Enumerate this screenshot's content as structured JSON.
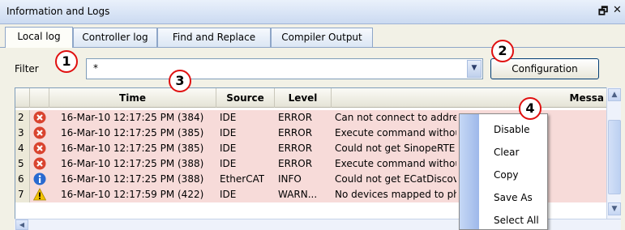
{
  "window": {
    "title": "Information and Logs",
    "pin_glyph": "🗗",
    "close_glyph": "✕"
  },
  "tabs": [
    {
      "label": "Local log",
      "active": true
    },
    {
      "label": "Controller log",
      "active": false
    },
    {
      "label": "Find and Replace",
      "active": false
    },
    {
      "label": "Compiler Output",
      "active": false
    }
  ],
  "filter": {
    "label": "Filter",
    "value": "*"
  },
  "configuration_button": "Configuration",
  "columns": {
    "time": "Time",
    "source": "Source",
    "level": "Level",
    "message": "Messa"
  },
  "rows": [
    {
      "num": "2",
      "icon": "error",
      "time": "16-Mar-10 12:17:25 PM (384)",
      "source": "IDE",
      "level": "ERROR",
      "message": "Can not connect to addre"
    },
    {
      "num": "3",
      "icon": "error",
      "time": "16-Mar-10 12:17:25 PM (385)",
      "source": "IDE",
      "level": "ERROR",
      "message": "Execute command withou"
    },
    {
      "num": "4",
      "icon": "error",
      "time": "16-Mar-10 12:17:25 PM (385)",
      "source": "IDE",
      "level": "ERROR",
      "message": "Could not get SinopeRTE"
    },
    {
      "num": "5",
      "icon": "error",
      "time": "16-Mar-10 12:17:25 PM (388)",
      "source": "IDE",
      "level": "ERROR",
      "message": "Execute command withou"
    },
    {
      "num": "6",
      "icon": "info",
      "time": "16-Mar-10 12:17:25 PM (388)",
      "source": "EtherCAT",
      "level": "INFO",
      "message": "Could not get ECatDiscov"
    },
    {
      "num": "7",
      "icon": "warning",
      "time": "16-Mar-10 12:17:59 PM (422)",
      "source": "IDE",
      "level": "WARN...",
      "message": "No devices mapped to ph"
    }
  ],
  "context_menu": [
    "Disable",
    "Clear",
    "Copy",
    "Save As",
    "Select All"
  ],
  "callouts": [
    "1",
    "2",
    "3",
    "4"
  ],
  "colors": {
    "row_bg": "#f7dbd9",
    "callout_border": "#e01010",
    "error_icon": "#d9432f",
    "info_icon": "#2a6ad0",
    "warning_icon": "#f2c200"
  }
}
